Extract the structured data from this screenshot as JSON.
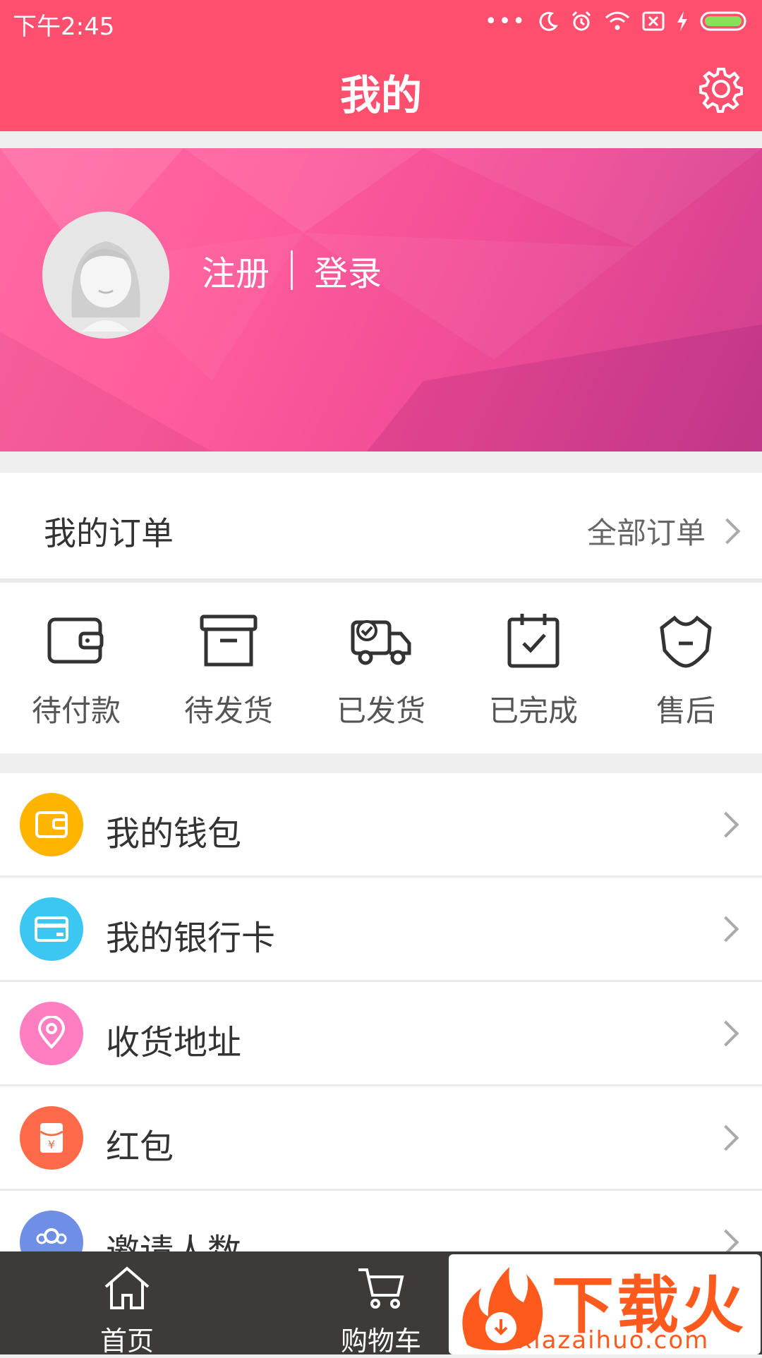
{
  "status_bar": {
    "time": "下午2:45"
  },
  "header": {
    "title": "我的"
  },
  "hero": {
    "register_label": "注册",
    "login_label": "登录"
  },
  "orders": {
    "title": "我的订单",
    "all_label": "全部订单",
    "statuses": [
      {
        "label": "待付款",
        "icon": "wallet-icon"
      },
      {
        "label": "待发货",
        "icon": "box-icon"
      },
      {
        "label": "已发货",
        "icon": "truck-icon"
      },
      {
        "label": "已完成",
        "icon": "calendar-check-icon"
      },
      {
        "label": "售后",
        "icon": "aftersale-icon"
      }
    ]
  },
  "menu": {
    "items": [
      {
        "label": "我的钱包",
        "icon": "wallet-icon",
        "color": "#ffb400"
      },
      {
        "label": "我的银行卡",
        "icon": "bank-card-icon",
        "color": "#3cc6f2"
      },
      {
        "label": "收货地址",
        "icon": "location-pin-icon",
        "color": "#ff7ec2"
      },
      {
        "label": "红包",
        "icon": "red-envelope-icon",
        "color": "#ff6a4a"
      },
      {
        "label": "邀请人数",
        "icon": "users-icon",
        "color": "#6f8fe6"
      }
    ]
  },
  "bottom_nav": {
    "home_label": "首页",
    "cart_label": "购物车"
  },
  "watermark": {
    "text": "下载火",
    "url": "xiazaihuo.com"
  },
  "colors": {
    "primary": "#ff4f6f",
    "nav_bg": "#3e3a3a"
  }
}
